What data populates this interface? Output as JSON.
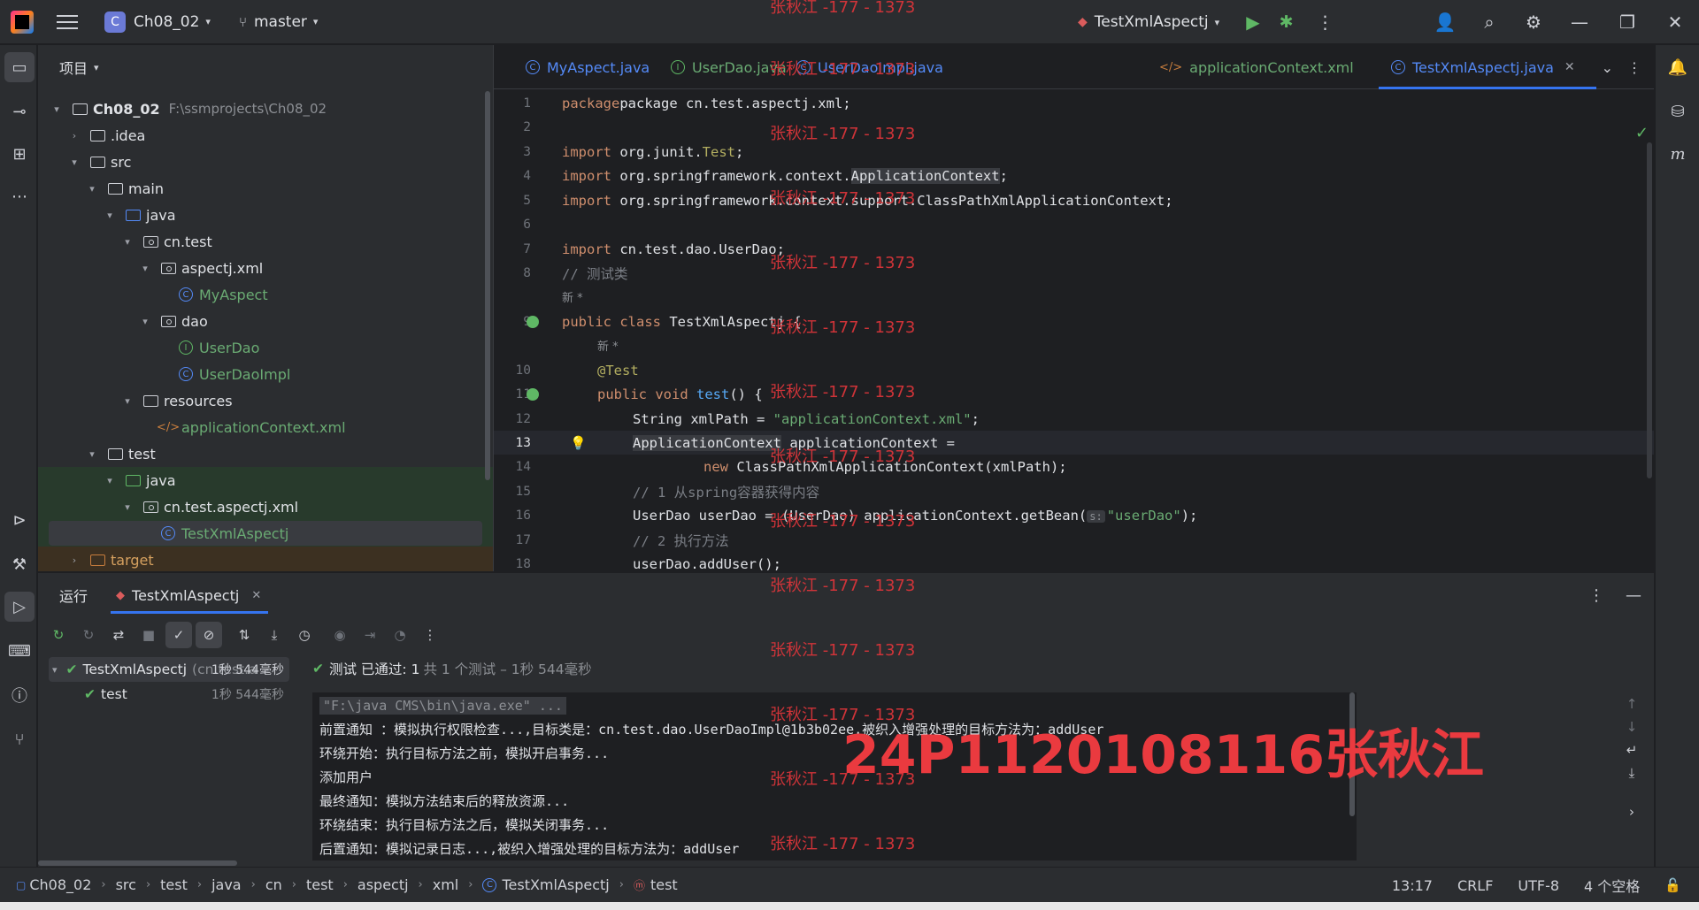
{
  "titlebar": {
    "project_badge": "C",
    "project": "Ch08_02",
    "branch": "master",
    "run_config": "TestXmlAspectj"
  },
  "project_panel": {
    "title": "项目",
    "tree": [
      {
        "label": "Ch08_02",
        "path": "F:\\ssmprojects\\Ch08_02"
      },
      {
        "label": ".idea"
      },
      {
        "label": "src"
      },
      {
        "label": "main"
      },
      {
        "label": "java"
      },
      {
        "label": "cn.test"
      },
      {
        "label": "aspectj.xml"
      },
      {
        "label": "MyAspect"
      },
      {
        "label": "dao"
      },
      {
        "label": "UserDao"
      },
      {
        "label": "UserDaoImpl"
      },
      {
        "label": "resources"
      },
      {
        "label": "applicationContext.xml"
      },
      {
        "label": "test"
      },
      {
        "label": "java"
      },
      {
        "label": "cn.test.aspectj.xml"
      },
      {
        "label": "TestXmlAspectj"
      },
      {
        "label": "target"
      }
    ]
  },
  "editor": {
    "tabs": [
      {
        "label": "MyAspect.java"
      },
      {
        "label": "UserDao.java"
      },
      {
        "label": "UserDaoImpl.java"
      },
      {
        "label": "applicationContext.xml"
      },
      {
        "label": "TestXmlAspectj.java"
      }
    ],
    "line_numbers": [
      "1",
      "2",
      "3",
      "4",
      "5",
      "6",
      "7",
      "8",
      "9",
      "10",
      "11",
      "12",
      "13",
      "14",
      "15",
      "16",
      "17",
      "18"
    ],
    "code": {
      "l1": "package cn.test.aspectj.xml;",
      "l3_kw": "import",
      "l3": " org.junit.",
      "l3_b": "Test",
      "l3_c": ";",
      "l4_kw": "import",
      "l4": " org.springframework.context.",
      "l4_b": "ApplicationContext",
      "l4_c": ";",
      "l5_kw": "import",
      "l5": " org.springframework.context.support.ClassPathXmlApplicationContext;",
      "l7_kw": "import",
      "l7": " cn.test.dao.UserDao;",
      "l8": "// 测试类",
      "lens1": "新 *",
      "l9_kw": "public class",
      "l9": " TestXmlAspectj {",
      "lens2": "新 *",
      "l10": "@Test",
      "l11_kw": "public void",
      "l11_fn": "test",
      "l11": "() {",
      "l12_a": "String xmlPath = ",
      "l12_s": "\"applicationContext.xml\"",
      "l12_c": ";",
      "l13_a": "ApplicationContext",
      "l13": " applicationContext =",
      "l14_kw": "new",
      "l14": " ClassPathXmlApplicationContext(xmlPath);",
      "l15": "// 1 从spring容器获得内容",
      "l16_a": "UserDao userDao = (UserDao) applicationContext.getBean(",
      "l16_hint": "s:",
      "l16_s": "\"userDao\"",
      "l16_c": ");",
      "l17": "// 2 执行方法",
      "l18": "userDao.addUser();"
    }
  },
  "run_panel": {
    "title": "运行",
    "tab": "TestXmlAspectj",
    "tests": [
      {
        "name": "TestXmlAspectj",
        "class": "(cn.test.a",
        "time": "1秒 544毫秒"
      },
      {
        "name": "test",
        "time": "1秒 544毫秒"
      }
    ],
    "status_main": "测试 已通过: 1",
    "status_dim": "共 1 个测试 – 1秒 544毫秒",
    "console": [
      "\"F:\\java CMS\\bin\\java.exe\" ...",
      "前置通知 ：模拟执行权限检查...,目标类是：cn.test.dao.UserDaoImpl@1b3b02ee,被织入增强处理的目标方法为：addUser",
      "环绕开始：执行目标方法之前，模拟开启事务...",
      "添加用户",
      "最终通知：模拟方法结束后的释放资源...",
      "环绕结束：执行目标方法之后，模拟关闭事务...",
      "后置通知：模拟记录日志...,被织入增强处理的目标方法为：addUser"
    ]
  },
  "statusbar": {
    "crumbs": [
      "Ch08_02",
      "src",
      "test",
      "java",
      "cn",
      "test",
      "aspectj",
      "xml",
      "TestXmlAspectj",
      "test"
    ],
    "position": "13:17",
    "line_sep": "CRLF",
    "encoding": "UTF-8",
    "indent": "4 个空格"
  },
  "watermark": {
    "small": "张秋江 -177 - 1373",
    "big": "24P1120108116张秋江"
  }
}
